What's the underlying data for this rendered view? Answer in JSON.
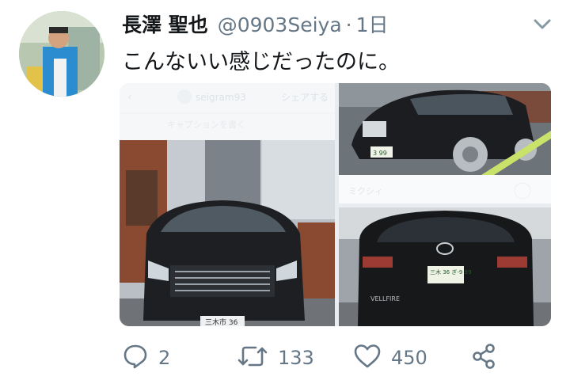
{
  "tweet": {
    "display_name": "長澤 聖也",
    "handle": "@0903Seiya",
    "separator": "·",
    "time": "1日",
    "text": "こんないい感じだったのに。"
  },
  "media": {
    "screenshot_overlay": {
      "account": "seigram93",
      "share": "シェアする",
      "caption_hint": "キャプションを書く",
      "footer": "ミクシィ"
    },
    "plates": {
      "front_bottom": "三木市 36",
      "rear": "三木 36 ぎ-9 99",
      "rear_badge": "VELLFIRE",
      "front_right": "3 99"
    }
  },
  "actions": {
    "reply_count": "2",
    "retweet_count": "133",
    "like_count": "450"
  },
  "colors": {
    "text": "#14171a",
    "secondary": "#657786"
  },
  "icons": [
    "chevron-down-icon",
    "reply-icon",
    "retweet-icon",
    "like-icon",
    "share-icon"
  ]
}
